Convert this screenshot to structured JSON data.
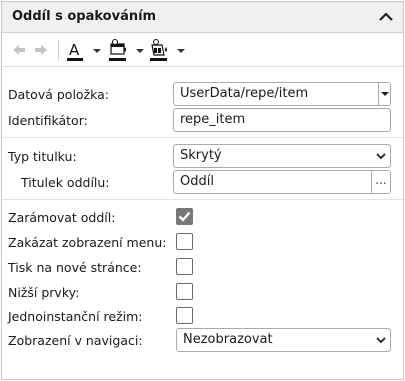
{
  "panel": {
    "title": "Oddíl s opakováním"
  },
  "toolbar": {
    "items": [
      "undo-icon",
      "redo-icon",
      "font-color-icon",
      "background-color-icon",
      "fill-color-icon"
    ]
  },
  "fields": {
    "data_item": {
      "label": "Datová položka:",
      "value": "UserData/repe/item"
    },
    "identifier": {
      "label": "Identifikátor:",
      "value": "repe_item"
    },
    "title_type": {
      "label": "Typ titulku:",
      "value": "Skrytý"
    },
    "section_title": {
      "label": "Titulek oddílu:",
      "value": "Oddíl",
      "button": "..."
    },
    "frame_section": {
      "label": "Zarámovat oddíl:",
      "checked": true
    },
    "disable_menu": {
      "label": "Zakázat zobrazení menu:",
      "checked": false
    },
    "print_new_page": {
      "label": "Tisk na nové stránce:",
      "checked": false
    },
    "lower_items": {
      "label": "Nižší prvky:",
      "checked": false
    },
    "single_instance": {
      "label": "Jednoinstanční režim:",
      "checked": false
    },
    "nav_display": {
      "label": "Zobrazení v navigaci:",
      "value": "Nezobrazovat"
    }
  },
  "colors": {
    "accent": "#1a3a8a",
    "checkbox_checked": "#777777"
  }
}
